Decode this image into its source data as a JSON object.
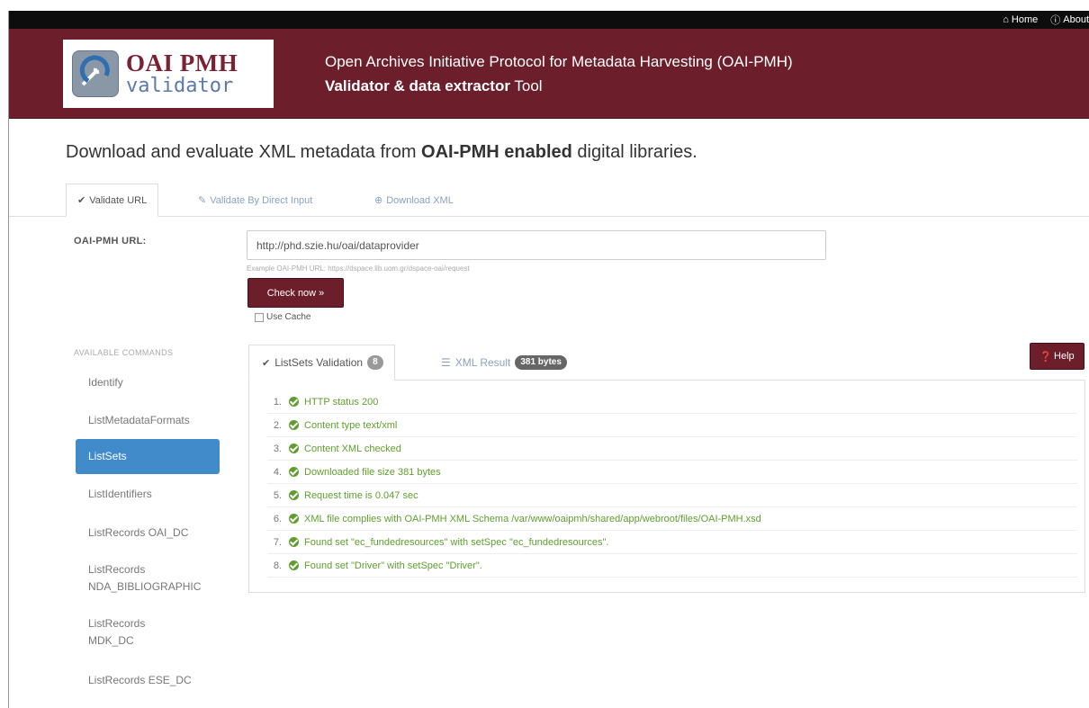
{
  "topnav": {
    "home_label": "Home",
    "about_label": "About"
  },
  "header": {
    "logo_top": "OAI PMH",
    "logo_bottom": "validator",
    "line1": "Open Archives Initiative Protocol for Metadata Harvesting (OAI-PMH)",
    "line2_bold": "Validator & data extractor",
    "line2_rest": " Tool"
  },
  "lead": {
    "part1": "Download and evaluate XML metadata from ",
    "bold": "OAI-PMH enabled",
    "part2": " digital libraries."
  },
  "tabs": [
    {
      "label": "Validate URL",
      "icon": "check-icon",
      "active": true
    },
    {
      "label": "Validate By Direct Input",
      "icon": "edit-icon",
      "active": false
    },
    {
      "label": "Download XML",
      "icon": "download-icon",
      "active": false
    }
  ],
  "form": {
    "url_label": "OAI-PMH URL:",
    "url_value": "http://phd.szie.hu/oai/dataprovider",
    "help_text": "Example OAI-PMH URL: https://dspace.lib.uom.gr/dspace-oai/request",
    "check_button": "Check now »",
    "use_cache_label": "Use Cache"
  },
  "commands": {
    "heading": "AVAILABLE COMMANDS",
    "items": [
      {
        "label1": "Identify",
        "label2": ""
      },
      {
        "label1": "ListMetadataFormats",
        "label2": ""
      },
      {
        "label1": "ListSets",
        "label2": ""
      },
      {
        "label1": "ListIdentifiers",
        "label2": ""
      },
      {
        "label1": "ListRecords OAI_DC",
        "label2": ""
      },
      {
        "label1": "ListRecords",
        "label2": "NDA_BIBLIOGRAPHIC"
      },
      {
        "label1": "ListRecords",
        "label2": "MDK_DC"
      },
      {
        "label1": "ListRecords ESE_DC",
        "label2": ""
      }
    ],
    "active_index": 2
  },
  "results_tabs": {
    "validation_label": "ListSets Validation",
    "validation_badge": "8",
    "xml_label": "XML Result",
    "xml_badge": "381 bytes",
    "help_button": "Help"
  },
  "results": [
    {
      "num": "1.",
      "text": "HTTP status 200"
    },
    {
      "num": "2.",
      "text": "Content type text/xml"
    },
    {
      "num": "3.",
      "text": "Content XML checked"
    },
    {
      "num": "4.",
      "text": "Downloaded file size 381 bytes"
    },
    {
      "num": "5.",
      "text": "Request time is 0.047 sec"
    },
    {
      "num": "6.",
      "text": "XML file complies with OAI-PMH XML Schema /var/www/oaipmh/shared/app/webroot/files/OAI-PMH.xsd"
    },
    {
      "num": "7.",
      "text": "Found set \"ec_fundedresources\" with setSpec \"ec_fundedresources\"."
    },
    {
      "num": "8.",
      "text": "Found set \"Driver\" with setSpec \"Driver\"."
    }
  ],
  "colors": {
    "brand": "#6d1e2b",
    "active_nav": "#428bca",
    "success": "#5f9e2e",
    "link": "#8aa3bf"
  }
}
